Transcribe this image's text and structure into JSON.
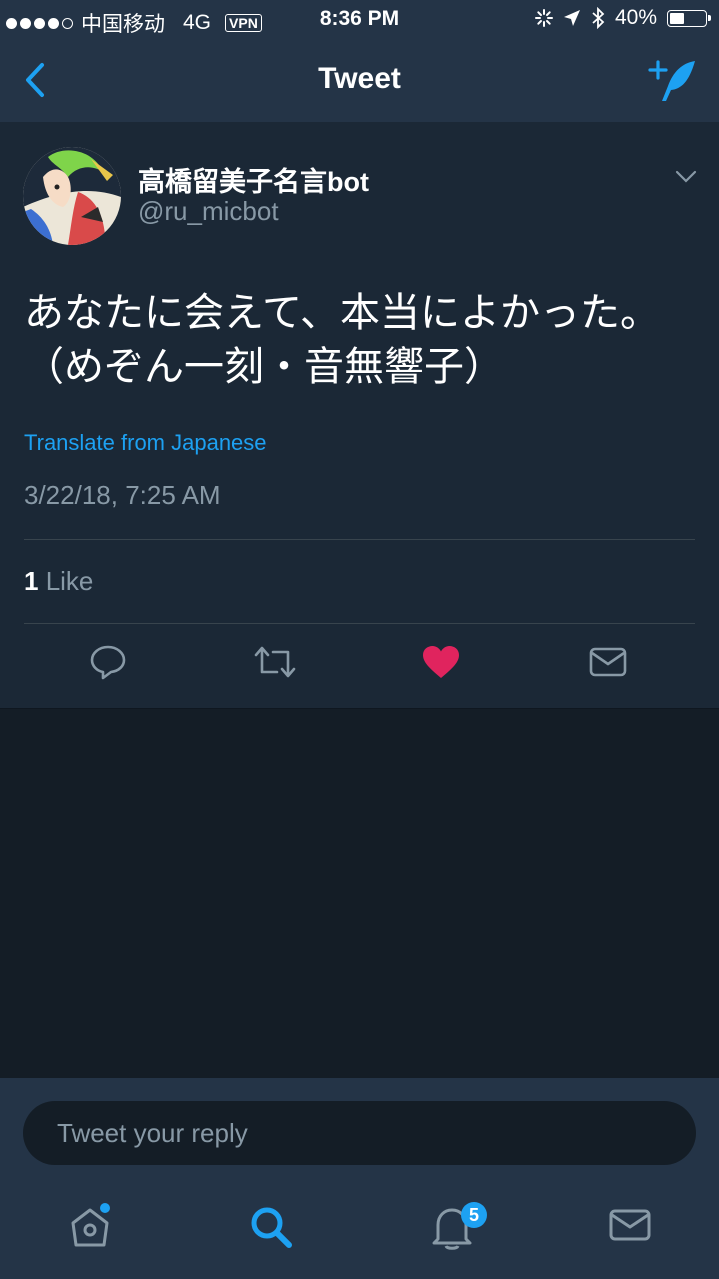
{
  "status_bar": {
    "carrier": "中国移动",
    "network": "4G",
    "vpn": "VPN",
    "time": "8:36 PM",
    "battery": "40%"
  },
  "nav": {
    "title": "Tweet"
  },
  "tweet": {
    "name": "高橋留美子名言bot",
    "handle": "@ru_micbot",
    "text_line1": "あなたに会えて、本当によかった。",
    "text_line2": "（めぞん一刻・音無響子）",
    "translate": "Translate from Japanese",
    "timestamp": "3/22/18, 7:25 AM",
    "like_count": "1",
    "like_label": " Like"
  },
  "reply": {
    "placeholder": "Tweet your reply"
  },
  "tabs": {
    "notifications_badge": "5"
  },
  "colors": {
    "accent": "#1da1f2",
    "like": "#e0245e",
    "background": "#141d26",
    "card": "#1b2836",
    "bar": "#243447"
  },
  "icons": [
    "back-chevron-icon",
    "compose-tweet-icon",
    "chevron-down-icon",
    "reply-icon",
    "retweet-icon",
    "like-heart-icon",
    "direct-message-icon",
    "home-icon",
    "search-icon",
    "notifications-bell-icon",
    "messages-icon"
  ]
}
